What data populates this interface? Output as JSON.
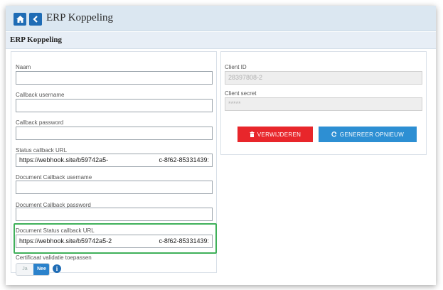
{
  "header": {
    "title": "ERP Koppeling",
    "home_icon": "home-icon",
    "back_icon": "chevron-left-icon"
  },
  "subheader": {
    "title": "ERP Koppeling"
  },
  "left_form": {
    "naam": {
      "label": "Naam",
      "value": ""
    },
    "callback_username": {
      "label": "Callback username",
      "value": ""
    },
    "callback_password": {
      "label": "Callback password",
      "value": ""
    },
    "status_callback_url": {
      "label": "Status callback URL",
      "value_start": "https://webhook.site/b59742a5-",
      "value_end": "c-8f62-85331439:"
    },
    "doc_callback_username": {
      "label": "Document Callback username",
      "value": ""
    },
    "doc_callback_password": {
      "label": "Document Callback password",
      "value": ""
    },
    "doc_status_callback_url": {
      "label": "Document Status callback URL",
      "value_start": "https://webhook.site/b59742a5-2",
      "value_end": "c-8f62-85331439:"
    },
    "certificaat": {
      "label": "Certificaat validatie toepassen",
      "toggle_ja": "Ja",
      "toggle_nee": "Nee",
      "selected": "Nee"
    }
  },
  "right_form": {
    "client_id": {
      "label": "Client ID",
      "value": "28397808-2"
    },
    "client_secret": {
      "label": "Client secret",
      "value": "*****"
    },
    "delete_button": "VERWIJDEREN",
    "regenerate_button": "GENEREER OPNIEUW"
  },
  "colors": {
    "primary": "#1f6cb5",
    "danger": "#e8262b",
    "info": "#2d8fd3",
    "highlight": "#3fb05a"
  }
}
